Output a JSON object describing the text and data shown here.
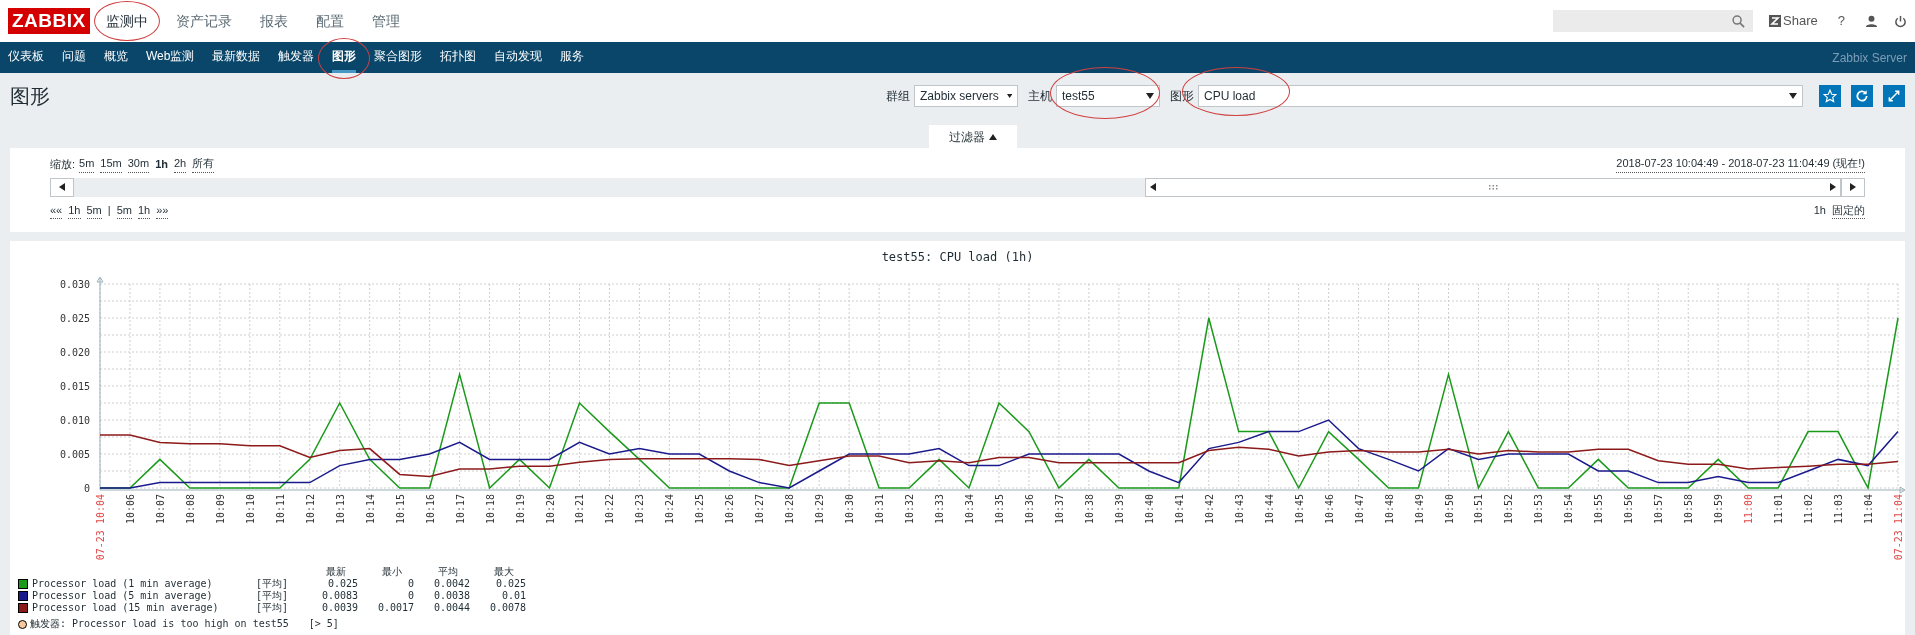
{
  "header": {
    "logo": "ZABBIX",
    "menu": [
      {
        "label": "监测中",
        "selected": true,
        "circled": true
      },
      {
        "label": "资产记录",
        "selected": false,
        "circled": false
      },
      {
        "label": "报表",
        "selected": false,
        "circled": false
      },
      {
        "label": "配置",
        "selected": false,
        "circled": false
      },
      {
        "label": "管理",
        "selected": false,
        "circled": false
      }
    ],
    "share": "Share",
    "help": "?"
  },
  "nav": {
    "items": [
      {
        "label": "仪表板",
        "selected": false,
        "circled": false
      },
      {
        "label": "问题",
        "selected": false,
        "circled": false
      },
      {
        "label": "概览",
        "selected": false,
        "circled": false
      },
      {
        "label": "Web监测",
        "selected": false,
        "circled": false
      },
      {
        "label": "最新数据",
        "selected": false,
        "circled": false
      },
      {
        "label": "触发器",
        "selected": false,
        "circled": false
      },
      {
        "label": "图形",
        "selected": true,
        "circled": true
      },
      {
        "label": "聚合图形",
        "selected": false,
        "circled": false
      },
      {
        "label": "拓扑图",
        "selected": false,
        "circled": false
      },
      {
        "label": "自动发现",
        "selected": false,
        "circled": false
      },
      {
        "label": "服务",
        "selected": false,
        "circled": false
      }
    ],
    "server": "Zabbix Server"
  },
  "page": {
    "title": "图形",
    "filters": [
      {
        "label": "群组",
        "value": "Zabbix servers",
        "circled": false,
        "kind": "short"
      },
      {
        "label": "主机",
        "value": "test55",
        "circled": true,
        "kind": "short"
      },
      {
        "label": "图形",
        "value": "CPU load",
        "circled": true,
        "kind": "wide"
      }
    ]
  },
  "filter": {
    "tab": "过滤器",
    "expanded": true,
    "zoom_label": "缩放:",
    "zoom_options": [
      {
        "label": "5m",
        "selected": false
      },
      {
        "label": "15m",
        "selected": false
      },
      {
        "label": "30m",
        "selected": false
      },
      {
        "label": "1h",
        "selected": true
      },
      {
        "label": "2h",
        "selected": false
      },
      {
        "label": "所有",
        "selected": false
      }
    ],
    "range": "2018-07-23 10:04:49 - 2018-07-23 11:04:49 (现在!)",
    "nav_links": [
      {
        "label": "««",
        "kind": "link"
      },
      {
        "label": "1h",
        "kind": "link"
      },
      {
        "label": "5m",
        "kind": "link"
      },
      {
        "label": "|",
        "kind": "separator"
      },
      {
        "label": "5m",
        "kind": "link"
      },
      {
        "label": "1h",
        "kind": "link"
      },
      {
        "label": "»»",
        "kind": "link"
      }
    ],
    "period": "1h",
    "fixed": "固定的"
  },
  "graph": {
    "chart_data": {
      "type": "line",
      "title": "test55: CPU load (1h)",
      "categories": [
        "07-23 10:04",
        "10:06",
        "10:07",
        "10:08",
        "10:09",
        "10:10",
        "10:11",
        "10:12",
        "10:13",
        "10:14",
        "10:15",
        "10:16",
        "10:17",
        "10:18",
        "10:19",
        "10:20",
        "10:21",
        "10:22",
        "10:23",
        "10:24",
        "10:25",
        "10:26",
        "10:27",
        "10:28",
        "10:29",
        "10:30",
        "10:31",
        "10:32",
        "10:33",
        "10:34",
        "10:35",
        "10:36",
        "10:37",
        "10:38",
        "10:39",
        "10:40",
        "10:41",
        "10:42",
        "10:43",
        "10:44",
        "10:45",
        "10:46",
        "10:47",
        "10:48",
        "10:49",
        "10:50",
        "10:51",
        "10:52",
        "10:53",
        "10:54",
        "10:55",
        "10:56",
        "10:57",
        "10:58",
        "10:59",
        "11:00",
        "11:01",
        "11:02",
        "11:03",
        "11:04",
        "07-23 11:04"
      ],
      "ylim": [
        0,
        0.03
      ],
      "grid": true,
      "yticks": [
        {
          "value": 0,
          "label": "0"
        },
        {
          "value": 0.005,
          "label": "0.005"
        },
        {
          "value": 0.01,
          "label": "0.010"
        },
        {
          "value": 0.015,
          "label": "0.015"
        },
        {
          "value": 0.02,
          "label": "0.020"
        },
        {
          "value": 0.025,
          "label": "0.025"
        },
        {
          "value": 0.03,
          "label": "0.030"
        }
      ],
      "series": [
        {
          "name": "Processor load (1 min average)",
          "color": "#1a9a1a",
          "values": [
            0,
            0,
            0.0042,
            0,
            0,
            0,
            0,
            0.0042,
            0.0125,
            0.0042,
            0,
            0,
            0.0167,
            0,
            0.0042,
            0,
            0.0125,
            0.0083,
            0.0042,
            0,
            0,
            0,
            0,
            0,
            0.0125,
            0.0125,
            0,
            0,
            0.0042,
            0,
            0.0125,
            0.0083,
            0,
            0.0042,
            0,
            0,
            0,
            0.025,
            0.0083,
            0.0083,
            0,
            0.0083,
            0.0042,
            0,
            0,
            0.0167,
            0,
            0.0083,
            0,
            0,
            0.0042,
            0,
            0,
            0,
            0.0042,
            0,
            0,
            0.0083,
            0.0083,
            0,
            0.025
          ]
        },
        {
          "name": "Processor load (5 min average)",
          "color": "#1a1a8c",
          "values": [
            0,
            0,
            0.0008,
            0.0008,
            0.0008,
            0.0008,
            0.0008,
            0.0008,
            0.0033,
            0.0042,
            0.0042,
            0.005,
            0.0067,
            0.0042,
            0.0042,
            0.0042,
            0.0067,
            0.005,
            0.0058,
            0.005,
            0.005,
            0.0025,
            0.0008,
            0,
            0.0025,
            0.005,
            0.005,
            0.005,
            0.0058,
            0.0033,
            0.0033,
            0.005,
            0.005,
            0.005,
            0.005,
            0.0025,
            0.0008,
            0.0058,
            0.0067,
            0.0083,
            0.0083,
            0.01,
            0.0058,
            0.0042,
            0.0025,
            0.0058,
            0.0042,
            0.005,
            0.005,
            0.005,
            0.0025,
            0.0025,
            0.0008,
            0.0008,
            0.0017,
            0.0008,
            0.0008,
            0.0025,
            0.0042,
            0.0033,
            0.0083
          ]
        },
        {
          "name": "Processor load (15 min average)",
          "color": "#8c1a1a",
          "values": [
            0.0078,
            0.0078,
            0.0067,
            0.0065,
            0.0065,
            0.0062,
            0.0062,
            0.0045,
            0.0055,
            0.0058,
            0.002,
            0.0017,
            0.0028,
            0.0028,
            0.0032,
            0.0032,
            0.0038,
            0.0042,
            0.0043,
            0.0043,
            0.0043,
            0.0043,
            0.0042,
            0.0033,
            0.004,
            0.0047,
            0.0047,
            0.0037,
            0.004,
            0.0037,
            0.0045,
            0.0045,
            0.0037,
            0.0037,
            0.0037,
            0.0037,
            0.0037,
            0.0055,
            0.006,
            0.0057,
            0.0047,
            0.0053,
            0.0055,
            0.0053,
            0.0053,
            0.0057,
            0.005,
            0.0055,
            0.0053,
            0.0053,
            0.0057,
            0.0057,
            0.004,
            0.0035,
            0.0035,
            0.0028,
            0.003,
            0.0032,
            0.0035,
            0.0035,
            0.0039
          ]
        }
      ]
    },
    "x_label_highlights": [
      true,
      false,
      false,
      false,
      false,
      false,
      false,
      false,
      false,
      false,
      false,
      false,
      false,
      false,
      false,
      false,
      false,
      false,
      false,
      false,
      false,
      false,
      false,
      false,
      false,
      false,
      false,
      false,
      false,
      false,
      false,
      false,
      false,
      false,
      false,
      false,
      false,
      false,
      false,
      false,
      false,
      false,
      false,
      false,
      false,
      false,
      false,
      false,
      false,
      false,
      false,
      false,
      false,
      false,
      false,
      true,
      false,
      false,
      false,
      false,
      true
    ],
    "legend": {
      "columns": [
        "最新",
        "最小",
        "平均",
        "最大"
      ],
      "items": [
        {
          "func": "[平均]",
          "values": [
            "0.025",
            "0",
            "0.0042",
            "0.025"
          ]
        },
        {
          "func": "[平均]",
          "values": [
            "0.0083",
            "0",
            "0.0038",
            "0.01"
          ]
        },
        {
          "func": "[平均]",
          "values": [
            "0.0039",
            "0.0017",
            "0.0044",
            "0.0078"
          ]
        }
      ],
      "trigger": {
        "label": "触发器: Processor load is too high on test55",
        "condition": "[> 5]",
        "color": "#f5c8a0"
      }
    }
  }
}
